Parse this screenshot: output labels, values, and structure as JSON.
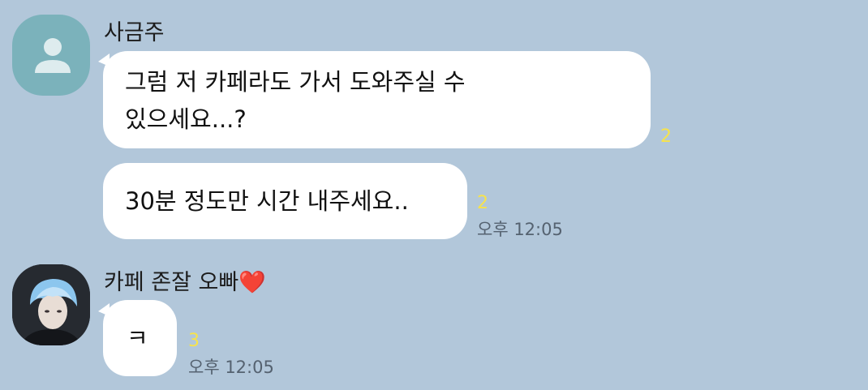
{
  "chat": {
    "groups": [
      {
        "sender": "사금주",
        "avatar_icon": "default-profile-icon",
        "messages": [
          {
            "lines": [
              "그럼 저 카페라도 가서 도와주실 수",
              "있으세요...?"
            ],
            "unread": "2"
          },
          {
            "lines": [
              "30분 정도만 시간 내주세요.."
            ],
            "unread": "2",
            "time": "오후 12:05"
          }
        ]
      },
      {
        "sender": "카페 존잘 오빠",
        "sender_emoji": "❤️",
        "avatar_icon": "profile-photo-icon",
        "messages": [
          {
            "lines": [
              "ㅋ"
            ],
            "unread": "3",
            "time": "오후 12:05"
          }
        ]
      }
    ]
  },
  "colors": {
    "background": "#b2c7da",
    "bubble": "#ffffff",
    "unread": "#f7e34b",
    "time": "#556270"
  }
}
